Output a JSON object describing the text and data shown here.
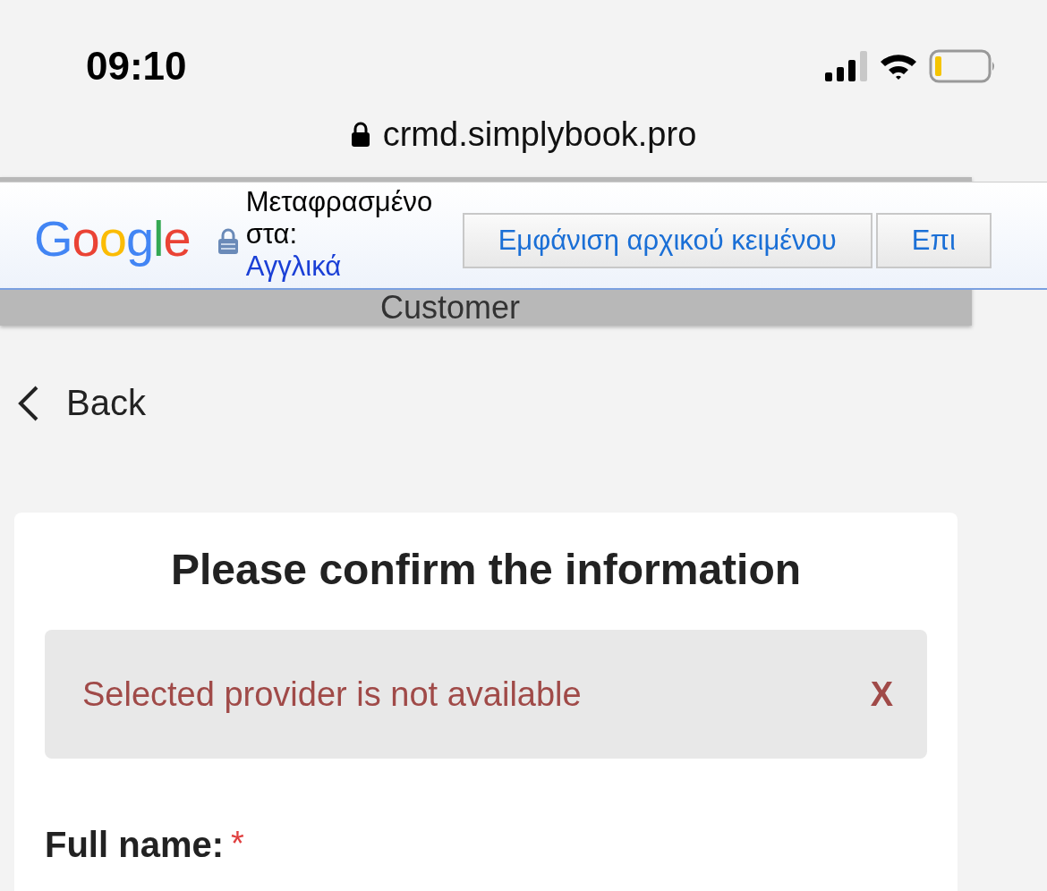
{
  "status_bar": {
    "time": "09:10"
  },
  "address_bar": {
    "url": "crmd.simplybook.pro"
  },
  "translate_bar": {
    "logo": "Google",
    "label_line_1": "Μεταφρασμένο",
    "label_line_2": "στα:",
    "language": "Αγγλικά",
    "buttons": [
      "Εμφάνιση αρχικού κειμένου",
      "Επι"
    ]
  },
  "header": {
    "title": "Customer"
  },
  "back": {
    "label": "Back"
  },
  "card": {
    "title": "Please confirm the information",
    "alert": {
      "message": "Selected provider is not available",
      "close": "X"
    },
    "fields": [
      {
        "label": "Full name:",
        "required": true,
        "marker": "*"
      }
    ]
  }
}
